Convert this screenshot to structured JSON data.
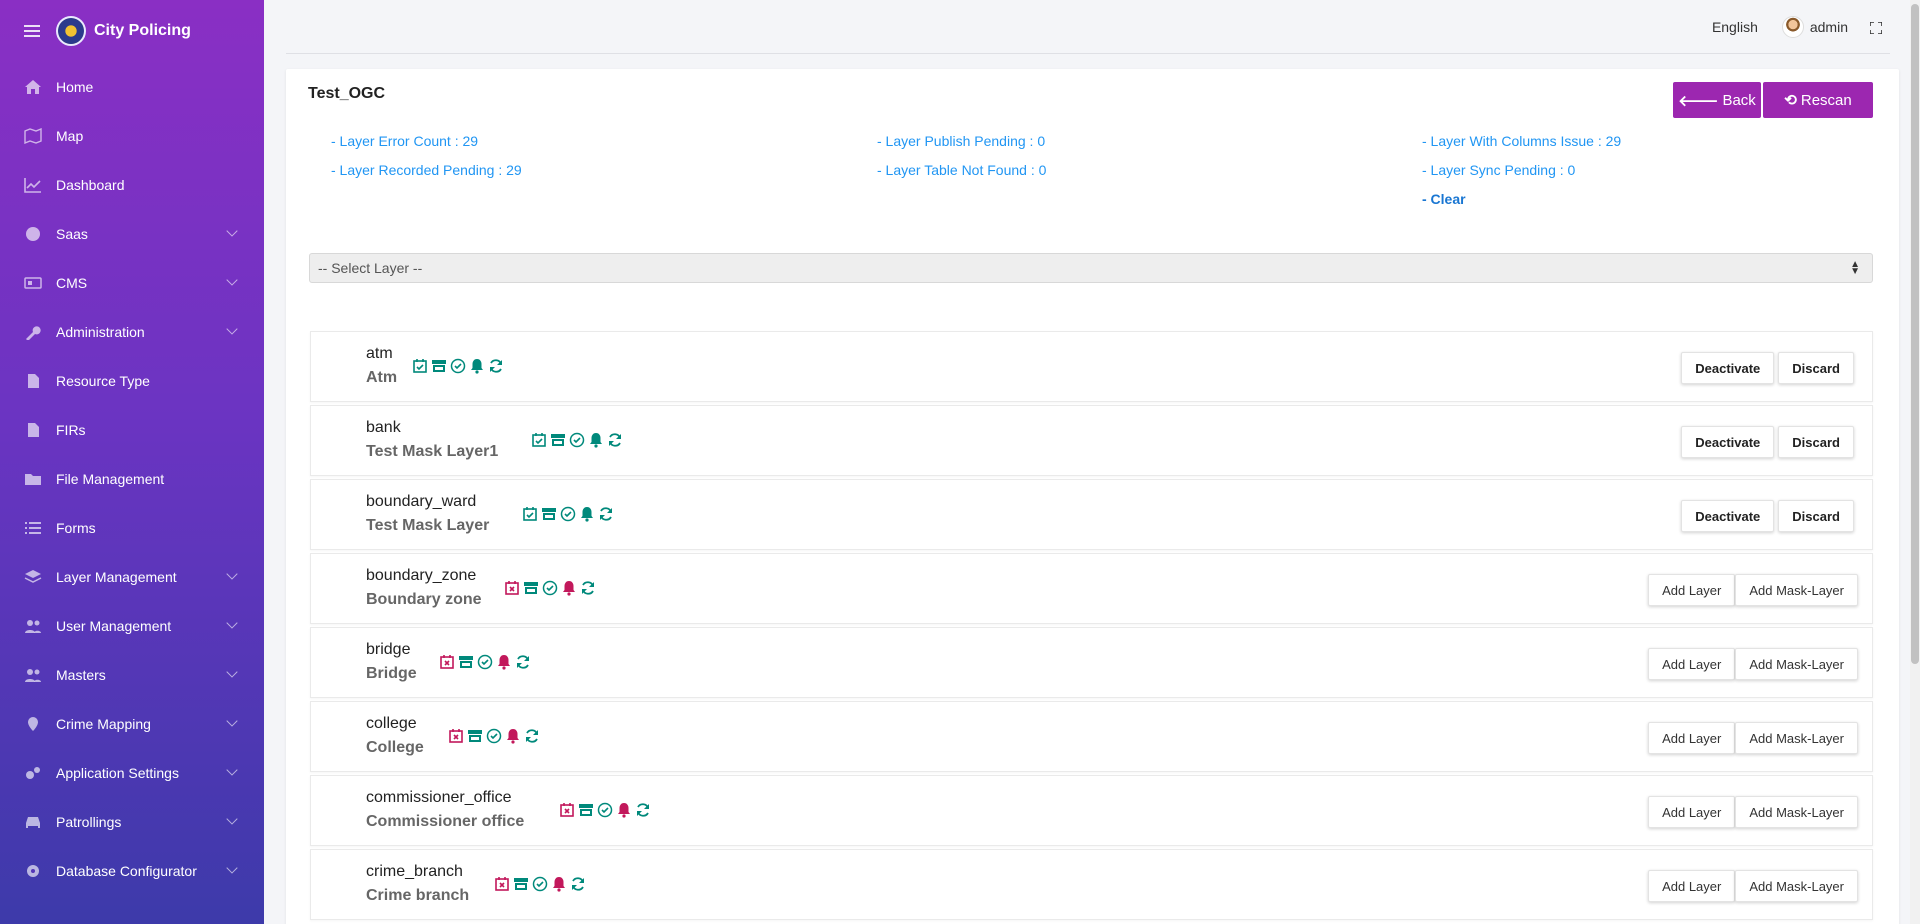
{
  "app": {
    "name": "City Policing"
  },
  "sidebar": {
    "items": [
      {
        "label": "Home",
        "icon": "home-icon",
        "has_children": false
      },
      {
        "label": "Map",
        "icon": "map-icon",
        "has_children": false
      },
      {
        "label": "Dashboard",
        "icon": "chart-icon",
        "has_children": false
      },
      {
        "label": "Saas",
        "icon": "globe-icon",
        "has_children": true
      },
      {
        "label": "CMS",
        "icon": "cms-icon",
        "has_children": true
      },
      {
        "label": "Administration",
        "icon": "wrench-icon",
        "has_children": true
      },
      {
        "label": "Resource Type",
        "icon": "document-icon",
        "has_children": false
      },
      {
        "label": "FIRs",
        "icon": "document-icon",
        "has_children": false
      },
      {
        "label": "File Management",
        "icon": "folder-icon",
        "has_children": false
      },
      {
        "label": "Forms",
        "icon": "list-icon",
        "has_children": false
      },
      {
        "label": "Layer Management",
        "icon": "layers-icon",
        "has_children": true
      },
      {
        "label": "User Management",
        "icon": "users-icon",
        "has_children": true
      },
      {
        "label": "Masters",
        "icon": "users-icon",
        "has_children": true
      },
      {
        "label": "Crime Mapping",
        "icon": "map-marker-icon",
        "has_children": true
      },
      {
        "label": "Application Settings",
        "icon": "gears-icon",
        "has_children": true
      },
      {
        "label": "Patrollings",
        "icon": "car-icon",
        "has_children": true
      },
      {
        "label": "Database Configurator",
        "icon": "gear-icon",
        "has_children": true
      }
    ]
  },
  "topbar": {
    "language": "English",
    "username": "admin"
  },
  "page": {
    "title": "Test_OGC",
    "back_label": "Back",
    "rescan_label": "Rescan",
    "stats": {
      "error_count": "- Layer Error Count : 29",
      "recorded_pending": "- Layer Recorded Pending : 29",
      "publish_pending": "- Layer Publish Pending : 0",
      "table_not_found": "- Layer Table Not Found : 0",
      "columns_issue": "- Layer With Columns Issue : 29",
      "sync_pending": "- Layer Sync Pending : 0",
      "clear": "- Clear"
    },
    "select_placeholder": "-- Select Layer --"
  },
  "colors": {
    "ok": "#00897b",
    "error": "#c2185b",
    "accent": "#9c27b0",
    "link": "#2196f3"
  },
  "layers": [
    {
      "name": "atm",
      "alias": "Atm",
      "recorded": true,
      "bell_ok": true,
      "actions": [
        "Deactivate",
        "Discard"
      ]
    },
    {
      "name": "bank",
      "alias": "Test Mask Layer1",
      "recorded": true,
      "bell_ok": true,
      "actions": [
        "Deactivate",
        "Discard"
      ]
    },
    {
      "name": "boundary_ward",
      "alias": "Test Mask Layer",
      "recorded": true,
      "bell_ok": true,
      "actions": [
        "Deactivate",
        "Discard"
      ]
    },
    {
      "name": "boundary_zone",
      "alias": "Boundary zone",
      "recorded": false,
      "bell_ok": false,
      "actions": [
        "Add Layer",
        "Add Mask-Layer"
      ]
    },
    {
      "name": "bridge",
      "alias": "Bridge",
      "recorded": false,
      "bell_ok": false,
      "actions": [
        "Add Layer",
        "Add Mask-Layer"
      ]
    },
    {
      "name": "college",
      "alias": "College",
      "recorded": false,
      "bell_ok": false,
      "actions": [
        "Add Layer",
        "Add Mask-Layer"
      ]
    },
    {
      "name": "commissioner_office",
      "alias": "Commissioner office",
      "recorded": false,
      "bell_ok": false,
      "actions": [
        "Add Layer",
        "Add Mask-Layer"
      ]
    },
    {
      "name": "crime_branch",
      "alias": "Crime branch",
      "recorded": false,
      "bell_ok": false,
      "actions": [
        "Add Layer",
        "Add Mask-Layer"
      ]
    }
  ]
}
